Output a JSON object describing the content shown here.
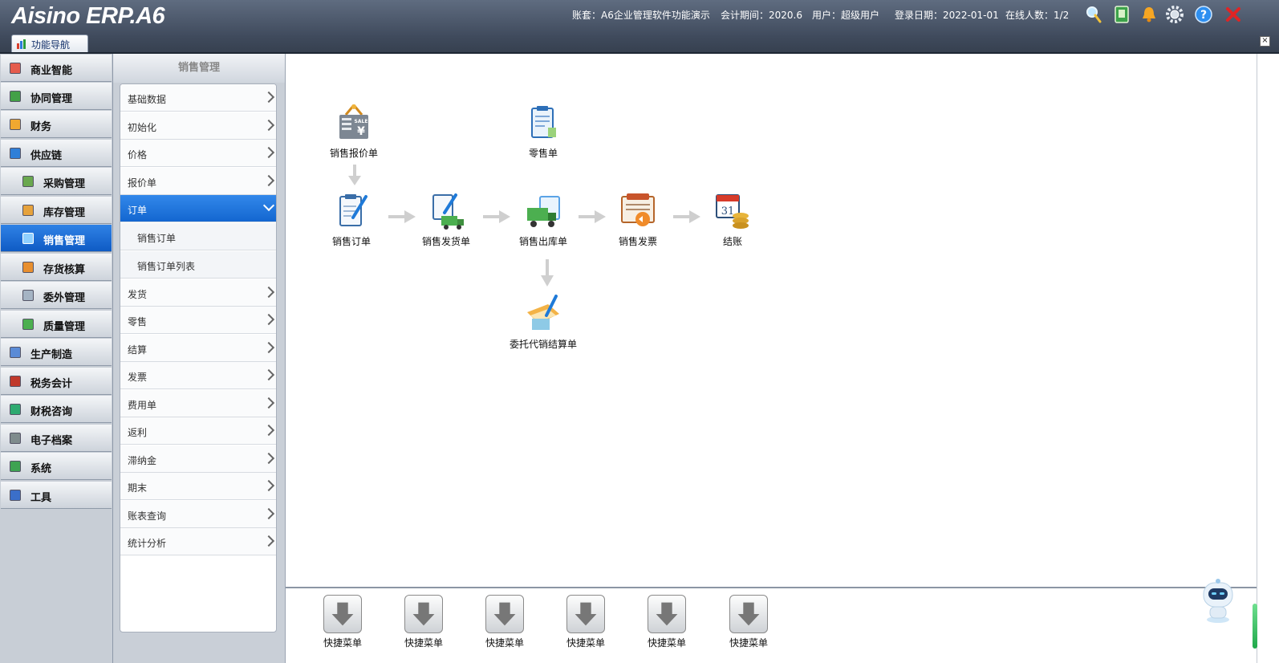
{
  "header": {
    "logo": "Aisino ERP.A6",
    "account_label": "账套：A6企业管理软件功能演示",
    "period_label": "会计期间：2020.6",
    "user_label": "用户：超级用户",
    "login_label": "登录日期：2022-01-01",
    "online_label": "在线人数：1/2"
  },
  "nav_tab": {
    "label": "功能导航",
    "close": "×"
  },
  "sidebar": {
    "items": [
      {
        "label": "商业智能"
      },
      {
        "label": "协同管理"
      },
      {
        "label": "财务"
      },
      {
        "label": "供应链"
      },
      {
        "label": "采购管理"
      },
      {
        "label": "库存管理"
      },
      {
        "label": "销售管理"
      },
      {
        "label": "存货核算"
      },
      {
        "label": "委外管理"
      },
      {
        "label": "质量管理"
      },
      {
        "label": "生产制造"
      },
      {
        "label": "税务会计"
      },
      {
        "label": "财税咨询"
      },
      {
        "label": "电子档案"
      },
      {
        "label": "系统"
      },
      {
        "label": "工具"
      }
    ]
  },
  "submenu": {
    "title": "销售管理",
    "items": [
      {
        "label": "基础数据"
      },
      {
        "label": "初始化"
      },
      {
        "label": "价格"
      },
      {
        "label": "报价单"
      },
      {
        "label": "订单"
      },
      {
        "label": "销售订单"
      },
      {
        "label": "销售订单列表"
      },
      {
        "label": "发货"
      },
      {
        "label": "零售"
      },
      {
        "label": "结算"
      },
      {
        "label": "发票"
      },
      {
        "label": "费用单"
      },
      {
        "label": "返利"
      },
      {
        "label": "滞纳金"
      },
      {
        "label": "期末"
      },
      {
        "label": "账表查询"
      },
      {
        "label": "统计分析"
      }
    ]
  },
  "flow": {
    "quote": "销售报价单",
    "retail": "零售单",
    "order": "销售订单",
    "delivery": "销售发货单",
    "outbound": "销售出库单",
    "invoice": "销售发票",
    "checkout": "结账",
    "consign": "委托代销结算单"
  },
  "quick_menu": {
    "items": [
      {
        "label": "快捷菜单"
      },
      {
        "label": "快捷菜单"
      },
      {
        "label": "快捷菜单"
      },
      {
        "label": "快捷菜单"
      },
      {
        "label": "快捷菜单"
      },
      {
        "label": "快捷菜单"
      }
    ]
  },
  "colors": {
    "accent": "#1466d0",
    "header": "#4a5568"
  }
}
